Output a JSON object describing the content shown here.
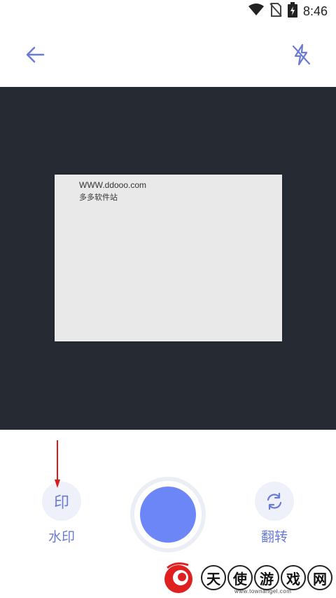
{
  "status_bar": {
    "time": "8:46",
    "icons": [
      "wifi-icon",
      "no-sim-icon",
      "battery-charging-icon"
    ]
  },
  "toolbar": {
    "back_icon": "arrow-left-icon",
    "flash_icon": "flash-off-icon"
  },
  "viewfinder": {
    "document_line1": "WWW.ddooo.com",
    "document_line2": "多多软件站"
  },
  "controls": {
    "watermark_icon_glyph": "印",
    "watermark_label": "水印",
    "flip_label": "翻转",
    "flip_icon": "rotate-icon"
  },
  "watermark_logo": {
    "chars": [
      "天",
      "使",
      "游",
      "戏",
      "网"
    ],
    "url": "www.townangel.com"
  },
  "colors": {
    "accent": "#6c86f7",
    "icon_blue": "#6a7bd6",
    "viewfinder_bg": "#252a33",
    "arrow_red": "#d71a1a"
  }
}
